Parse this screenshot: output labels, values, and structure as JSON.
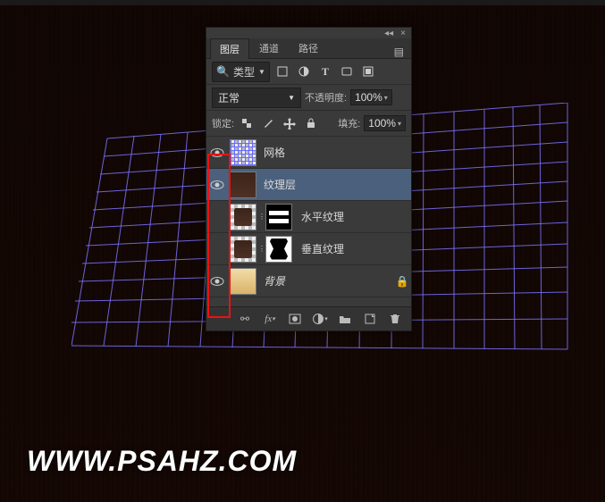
{
  "watermark": "WWW.PSAHZ.COM",
  "panel": {
    "tabs": [
      "图层",
      "通道",
      "路径"
    ],
    "active_tab": 0,
    "filter": {
      "search_icon": "search-icon",
      "type_label": "类型",
      "buttons": [
        "pixel",
        "adjust",
        "type",
        "shape",
        "smart"
      ]
    },
    "blend": {
      "mode": "正常",
      "opacity_label": "不透明度:",
      "opacity_value": "100%"
    },
    "lock": {
      "label": "锁定:",
      "fill_label": "填充:",
      "fill_value": "100%"
    },
    "layers": [
      {
        "visible": true,
        "name": "网格",
        "thumb": "grid",
        "mask": null,
        "locked": false
      },
      {
        "visible": true,
        "name": "纹理层",
        "thumb": "tex",
        "mask": null,
        "locked": false,
        "selected": true
      },
      {
        "visible": false,
        "name": "水平纹理",
        "thumb": "tex",
        "mask": "horiz",
        "locked": false
      },
      {
        "visible": false,
        "name": "垂直纹理",
        "thumb": "tex",
        "mask": "vert",
        "locked": false
      },
      {
        "visible": true,
        "name": "背景",
        "thumb": "gradient",
        "mask": null,
        "locked": true
      }
    ],
    "footer_icons": [
      "link",
      "fx",
      "mask",
      "adjust",
      "group",
      "new",
      "trash"
    ]
  }
}
